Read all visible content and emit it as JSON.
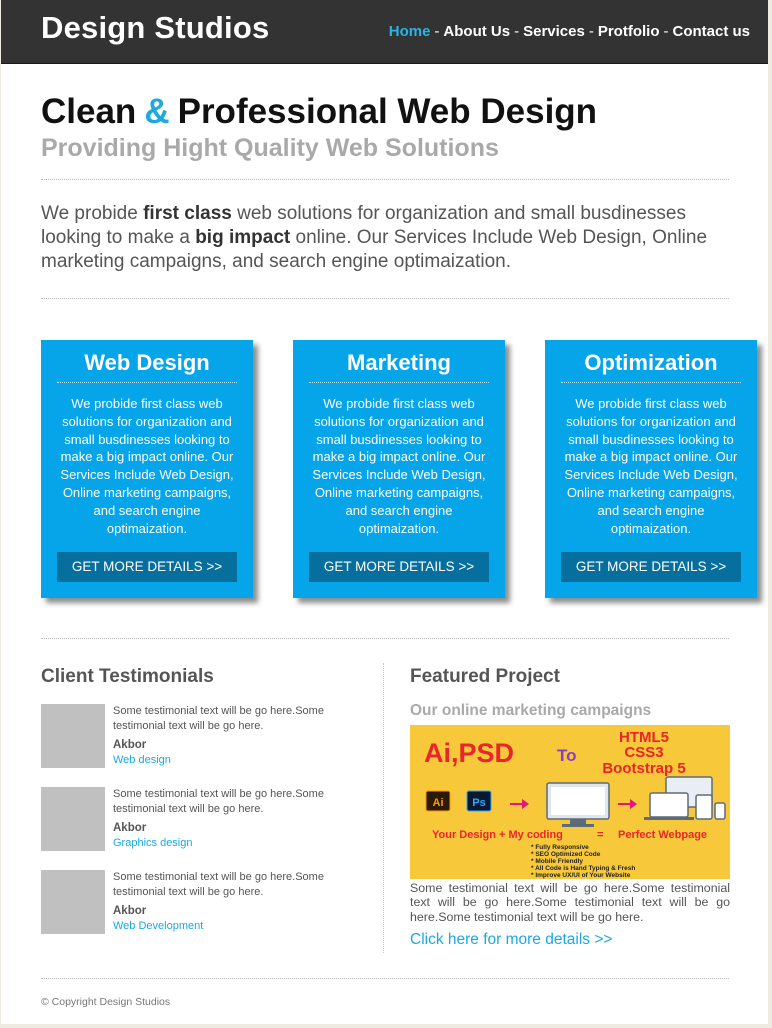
{
  "header": {
    "logo": "Design Studios",
    "nav": [
      {
        "label": "Home",
        "active": true
      },
      {
        "label": "About Us",
        "active": false
      },
      {
        "label": "Services",
        "active": false
      },
      {
        "label": "Protfolio",
        "active": false
      },
      {
        "label": "Contact us",
        "active": false
      }
    ],
    "nav_separator": "-"
  },
  "hero": {
    "title_part1": "Clean",
    "title_amp": "&",
    "title_part2": "Professional Web Design",
    "subtitle": "Providing Hight Quality Web Solutions",
    "intro": {
      "p1": "We probide ",
      "b1": "first class",
      "p2": " web solutions for organization and small busdinesses looking to make a ",
      "b2": "big impact",
      "p3": " online. Our Services Include Web Design, Online marketing campaigns, and search engine optimaization."
    }
  },
  "cards": [
    {
      "title": "Web Design",
      "text": "We probide first class web solutions for organization and small busdinesses looking to make a big impact online. Our Services Include Web Design, Online marketing campaigns, and search engine optimaization.",
      "button": "GET MORE DETAILS >>"
    },
    {
      "title": "Marketing",
      "text": "We probide first class web solutions for organization and small busdinesses looking to make a big impact online. Our Services Include Web Design, Online marketing campaigns, and search engine optimaization.",
      "button": "GET MORE DETAILS >>"
    },
    {
      "title": "Optimization",
      "text": "We probide first class web solutions for organization and small busdinesses looking to make a big impact online. Our Services Include Web Design, Online marketing campaigns, and search engine optimaization.",
      "button": "GET MORE DETAILS >>"
    }
  ],
  "testimonials": {
    "title": "Client Testimonials",
    "items": [
      {
        "text": "Some testimonial text will be go here.Some testimonial text will be go here.",
        "name": "Akbor",
        "role": "Web design"
      },
      {
        "text": "Some testimonial text will be go here.Some testimonial text will be go here.",
        "name": "Akbor",
        "role": "Graphics design"
      },
      {
        "text": "Some testimonial text will be go here.Some testimonial text will be go here.",
        "name": "Akbor",
        "role": "Web Development"
      }
    ]
  },
  "featured": {
    "title": "Featured Project",
    "subtitle": "Our online marketing campaigns",
    "image": {
      "left_text": "Ai,PSD",
      "to_text": "To",
      "right_lines": [
        "HTML5",
        "CSS3",
        "Bootstrap 5"
      ],
      "icon_ai": "Ai",
      "icon_ps": "Ps",
      "equation_left": "Your Design + My coding",
      "equals": "=",
      "equation_right": "Perfect Webpage",
      "bullets": [
        "* Fully Responsive",
        "* SEO Optimized Code",
        "* Mobile Friendly",
        "* All Code is Hand Typing & Fresh",
        "* Improve UX/UI of Your Website"
      ],
      "colors": {
        "background": "#f6c83a",
        "red": "#e8262b",
        "purple": "#8a3bd1",
        "pink": "#e8157d"
      }
    },
    "text": "Some testimonial text will be go here.Some testimonial text will be go here.Some testimonial text will be go here.Some testimonial text will be go here.",
    "link": "Click here for more details >>"
  },
  "footer": {
    "copyright": "© Copyright Design Studios"
  }
}
